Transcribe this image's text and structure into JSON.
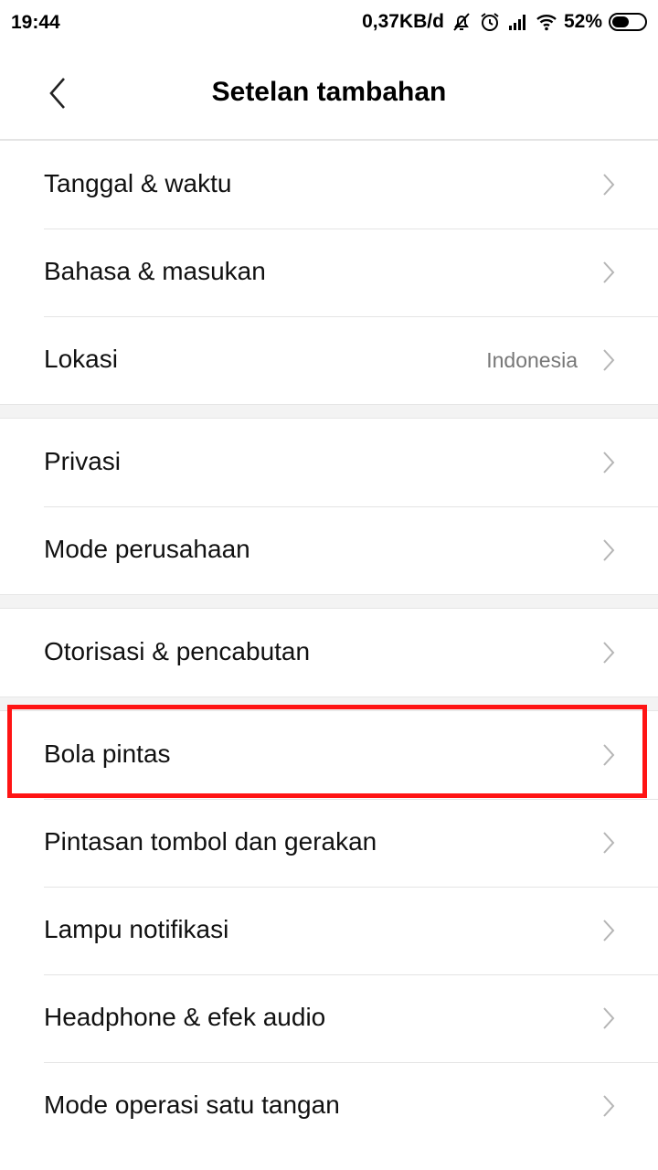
{
  "status": {
    "time": "19:44",
    "net_speed": "0,37KB/d",
    "battery": "52%",
    "battery_level": 0.52,
    "icons": [
      "mute-icon",
      "alarm-icon",
      "signal-icon",
      "wifi-icon",
      "battery-icon"
    ]
  },
  "header": {
    "title": "Setelan tambahan",
    "back_icon": "chevron-left-icon"
  },
  "groups": [
    {
      "items": [
        {
          "label": "Tanggal & waktu",
          "value": ""
        },
        {
          "label": "Bahasa & masukan",
          "value": ""
        },
        {
          "label": "Lokasi",
          "value": "Indonesia"
        }
      ]
    },
    {
      "items": [
        {
          "label": "Privasi",
          "value": ""
        },
        {
          "label": "Mode perusahaan",
          "value": ""
        }
      ]
    },
    {
      "items": [
        {
          "label": "Otorisasi & pencabutan",
          "value": ""
        }
      ]
    },
    {
      "items": [
        {
          "label": "Bola pintas",
          "value": ""
        },
        {
          "label": "Pintasan tombol dan gerakan",
          "value": ""
        },
        {
          "label": "Lampu notifikasi",
          "value": ""
        },
        {
          "label": "Headphone & efek audio",
          "value": ""
        },
        {
          "label": "Mode operasi satu tangan",
          "value": ""
        }
      ]
    }
  ],
  "highlight_color": "#ff1414"
}
